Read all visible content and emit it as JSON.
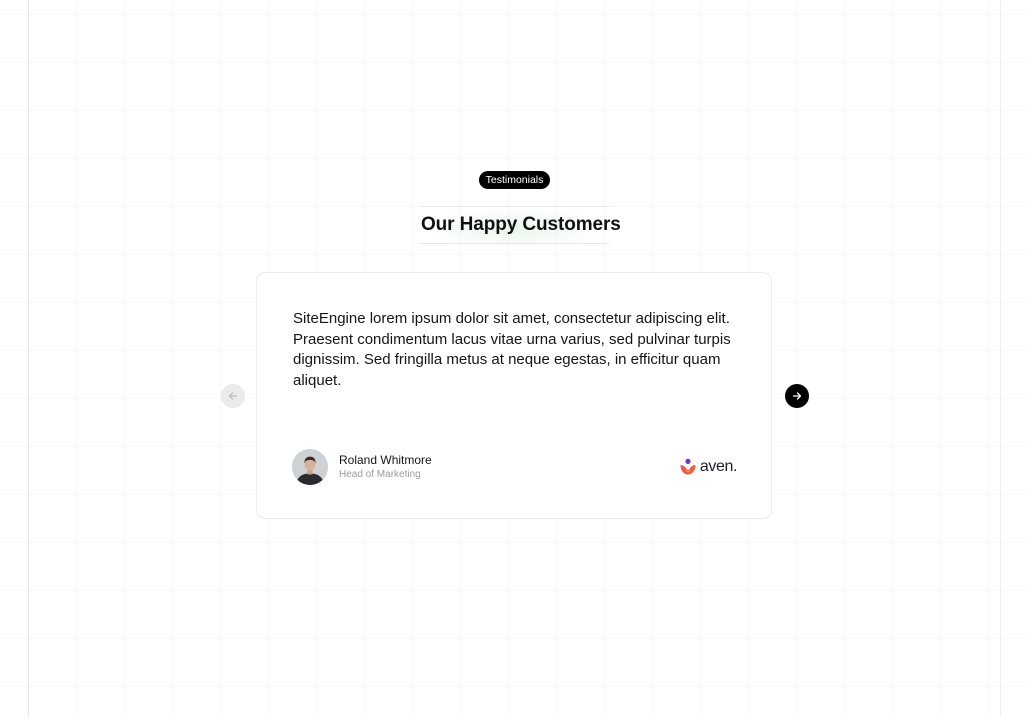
{
  "section": {
    "badge_label": "Testimonials",
    "title": "Our Happy Customers"
  },
  "testimonial": {
    "quote": "SiteEngine lorem ipsum dolor sit amet, consectetur adipiscing elit. Praesent condimentum lacus vitae urna varius, sed pulvinar turpis dignissim. Sed fringilla metus at neque egestas, in efficitur quam aliquet.",
    "author": {
      "name": "Roland Whitmore",
      "role": "Head of Marketing",
      "avatar_icon": "person-avatar"
    },
    "company": {
      "name": "aven.",
      "logo_colors": [
        "#6a3bb5",
        "#e8455a",
        "#f39a3c"
      ]
    }
  },
  "navigation": {
    "prev_icon": "arrow-left-icon",
    "next_icon": "arrow-right-icon",
    "prev_enabled": false,
    "next_enabled": true
  },
  "colors": {
    "badge_bg": "#000000",
    "next_button_bg": "#000000",
    "prev_button_bg": "#ebebeb",
    "card_border": "#ececec",
    "muted_text": "#9a9ca0"
  }
}
